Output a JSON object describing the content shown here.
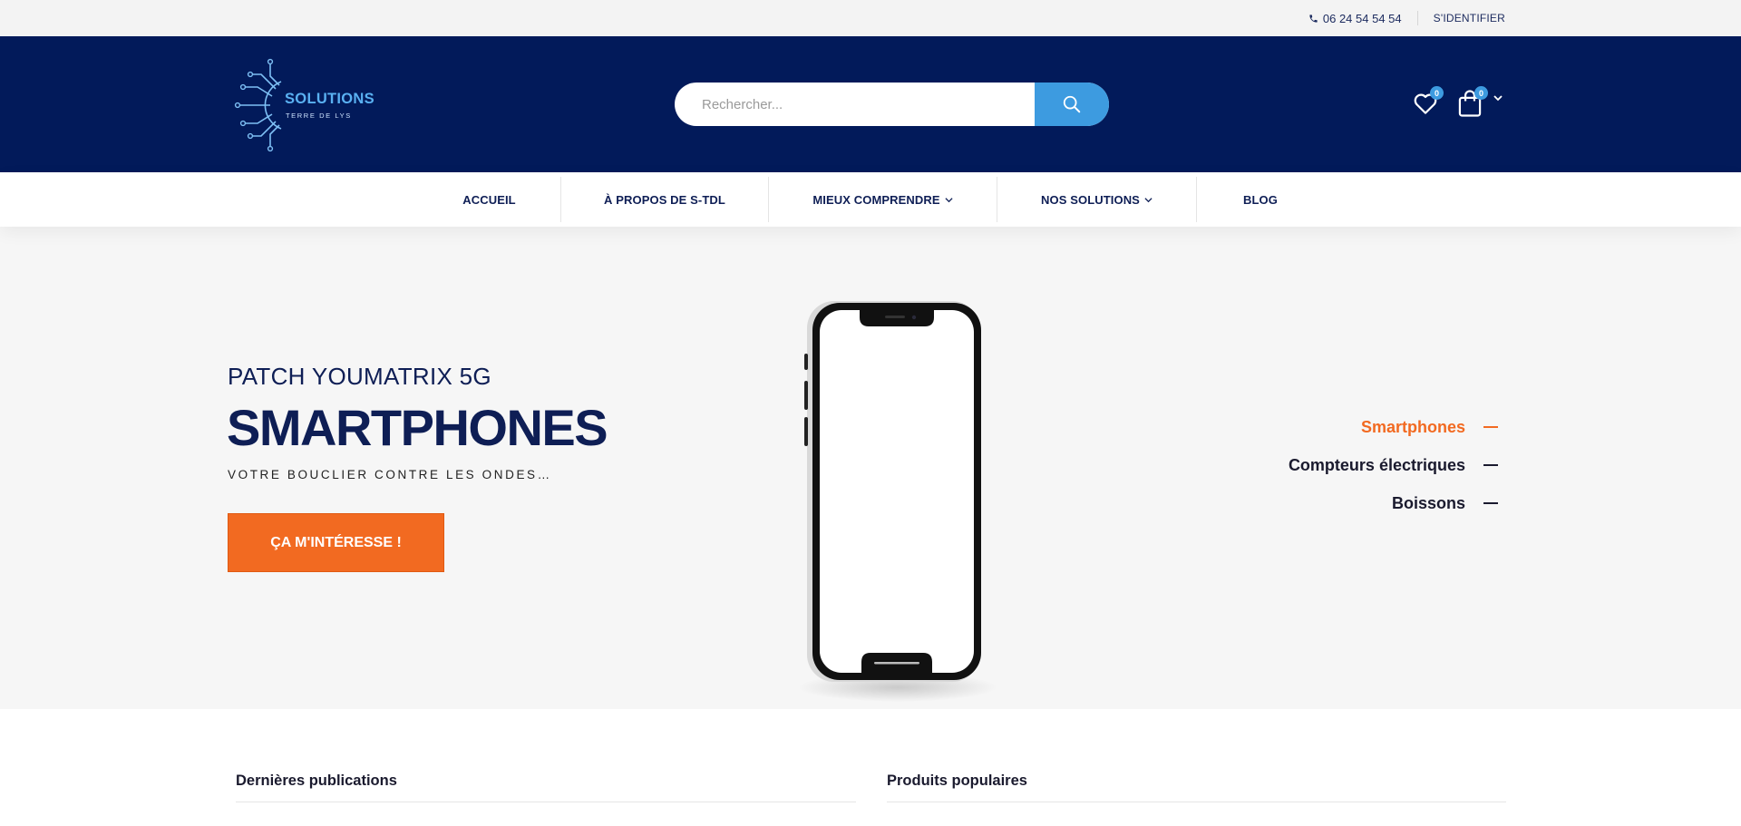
{
  "topbar": {
    "phone_icon": "phone-icon",
    "phone": "06 24 54 54 54",
    "signin": "S'identifier"
  },
  "header": {
    "logo_title": "SOLUTIONS",
    "logo_subtitle": "TERRE DE LYS",
    "search_placeholder": "Rechercher...",
    "search_icon": "search-icon",
    "wishlist_count": "0",
    "cart_count": "0",
    "brand_color": "#021a5a",
    "accent_color": "#3d9be0"
  },
  "nav": {
    "items": [
      {
        "label": "ACCUEIL",
        "dropdown": false
      },
      {
        "label": "À PROPOS DE S-TDL",
        "dropdown": false
      },
      {
        "label": "MIEUX COMPRENDRE",
        "dropdown": true
      },
      {
        "label": "NOS SOLUTIONS",
        "dropdown": true
      },
      {
        "label": "BLOG",
        "dropdown": false
      }
    ]
  },
  "hero": {
    "subtitle": "PATCH YOUMATRIX 5G",
    "title": "SMARTPHONES",
    "tagline": "VOTRE BOUCLIER CONTRE LES ONDES…",
    "cta": "ÇA M'INTÉRESSE !",
    "cta_color": "#f26a21",
    "slides": [
      {
        "label": "Smartphones",
        "active": true
      },
      {
        "label": "Compteurs électriques",
        "active": false
      },
      {
        "label": "Boissons",
        "active": false
      }
    ]
  },
  "sections": {
    "latest_posts": "Dernières publications",
    "popular_products": "Produits populaires"
  }
}
